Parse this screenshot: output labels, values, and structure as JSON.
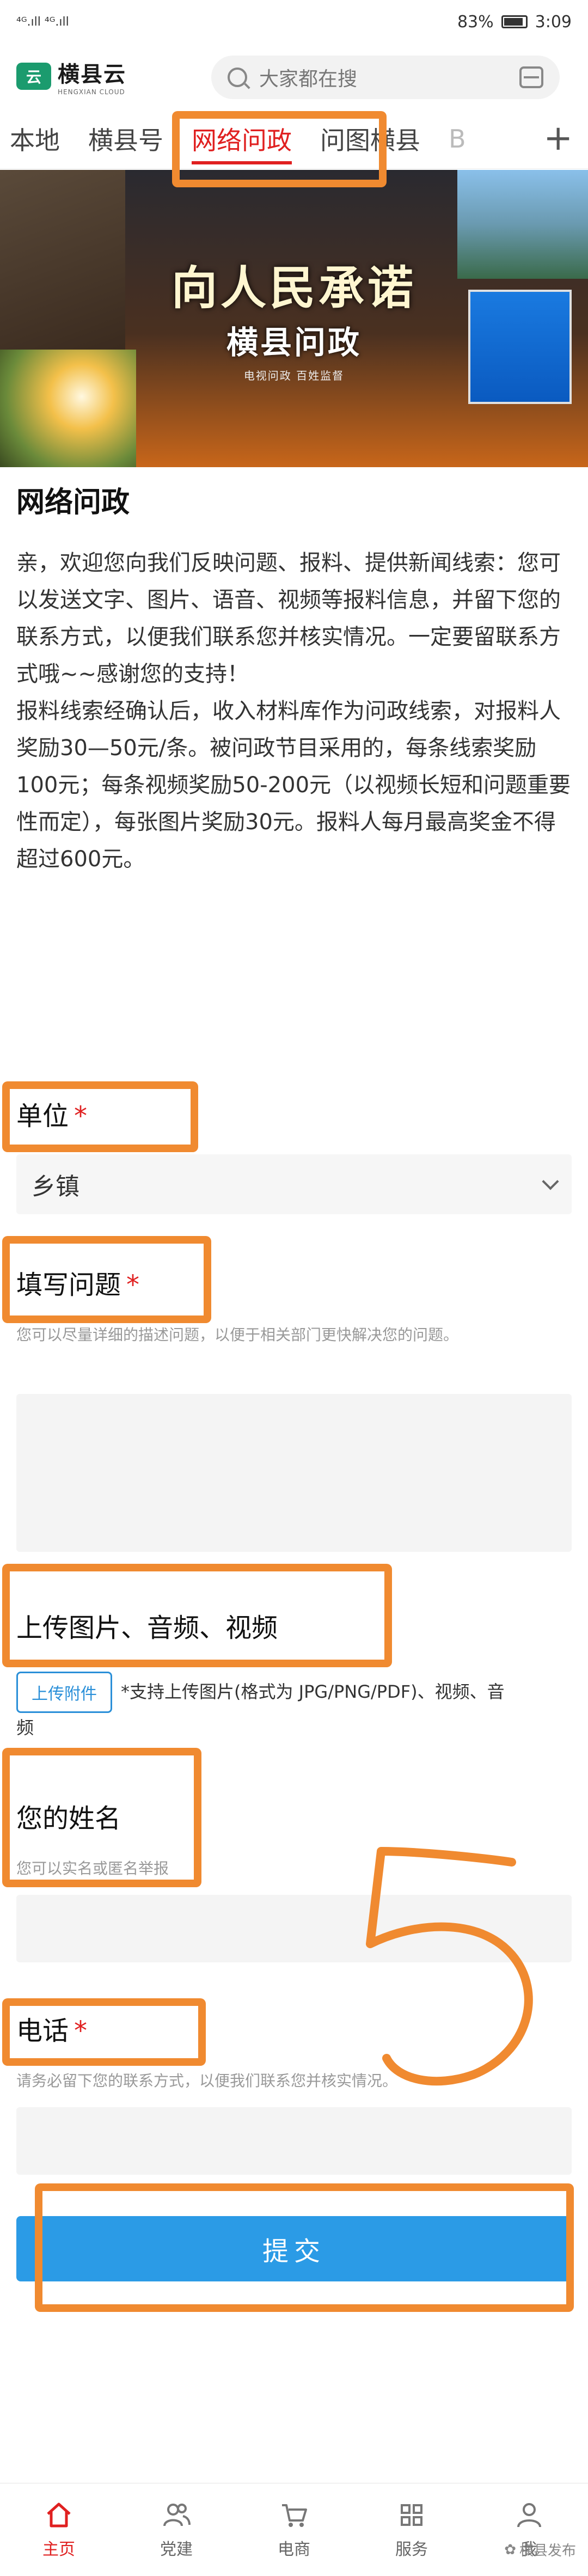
{
  "status_bar": {
    "signal": "⁴ᴳ.ıll ⁴ᴳ.ıll",
    "battery_percent": "83%",
    "time": "3:09"
  },
  "header": {
    "logo_name": "横县云",
    "logo_sub": "HENGXIAN CLOUD",
    "search_placeholder": "大家都在搜"
  },
  "tabs": [
    {
      "label": "本地"
    },
    {
      "label": "横县号"
    },
    {
      "label": "网络问政",
      "active": true
    },
    {
      "label": "问图横县"
    },
    {
      "label": "B"
    }
  ],
  "banner": {
    "title": "向人民承诺",
    "subtitle": "横县问政",
    "caption": "电视问政 百姓监督"
  },
  "page": {
    "title": "网络问政",
    "intro_p1": "亲，欢迎您向我们反映问题、报料、提供新闻线索：您可以发送文字、图片、语音、视频等报料信息，并留下您的联系方式，以便我们联系您并核实情况。一定要留联系方式哦~~感谢您的支持！",
    "intro_p2": "报料线索经确认后，收入材料库作为问政线索，对报料人奖励30—50元/条。被问政节目采用的，每条线索奖励100元；每条视频奖励50-200元（以视频长短和问题重要性而定），每张图片奖励30元。报料人每月最高奖金不得超过600元。"
  },
  "form": {
    "unit_label": "单位",
    "unit_value": "乡镇",
    "question_label": "填写问题",
    "question_hint": "您可以尽量详细的描述问题，以便于相关部门更快解决您的问题。",
    "upload_label": "上传图片、音频、视频",
    "upload_button": "上传附件",
    "upload_note_a": "*支持上传图片(格式为 JPG/PNG/PDF)、视频、音",
    "upload_note_b": "频",
    "name_label": "您的姓名",
    "name_hint": "您可以实名或匿名举报",
    "phone_label": "电话",
    "phone_hint": "请务必留下您的联系方式，以便我们联系您并核实情况。",
    "required_mark": "*",
    "submit_label": "提交"
  },
  "bottom_nav": [
    {
      "label": "主页",
      "icon": "home-icon",
      "active": true
    },
    {
      "label": "党建",
      "icon": "people-icon"
    },
    {
      "label": "电商",
      "icon": "cart-icon"
    },
    {
      "label": "服务",
      "icon": "service-icon"
    },
    {
      "label": "我",
      "icon": "user-icon"
    }
  ],
  "watermark": "横县发布",
  "annotation_text": "5",
  "colors": {
    "accent": "#e02020",
    "primary_button": "#2b9be6",
    "highlight": "#f08a30",
    "brand": "#1b9b6e"
  }
}
